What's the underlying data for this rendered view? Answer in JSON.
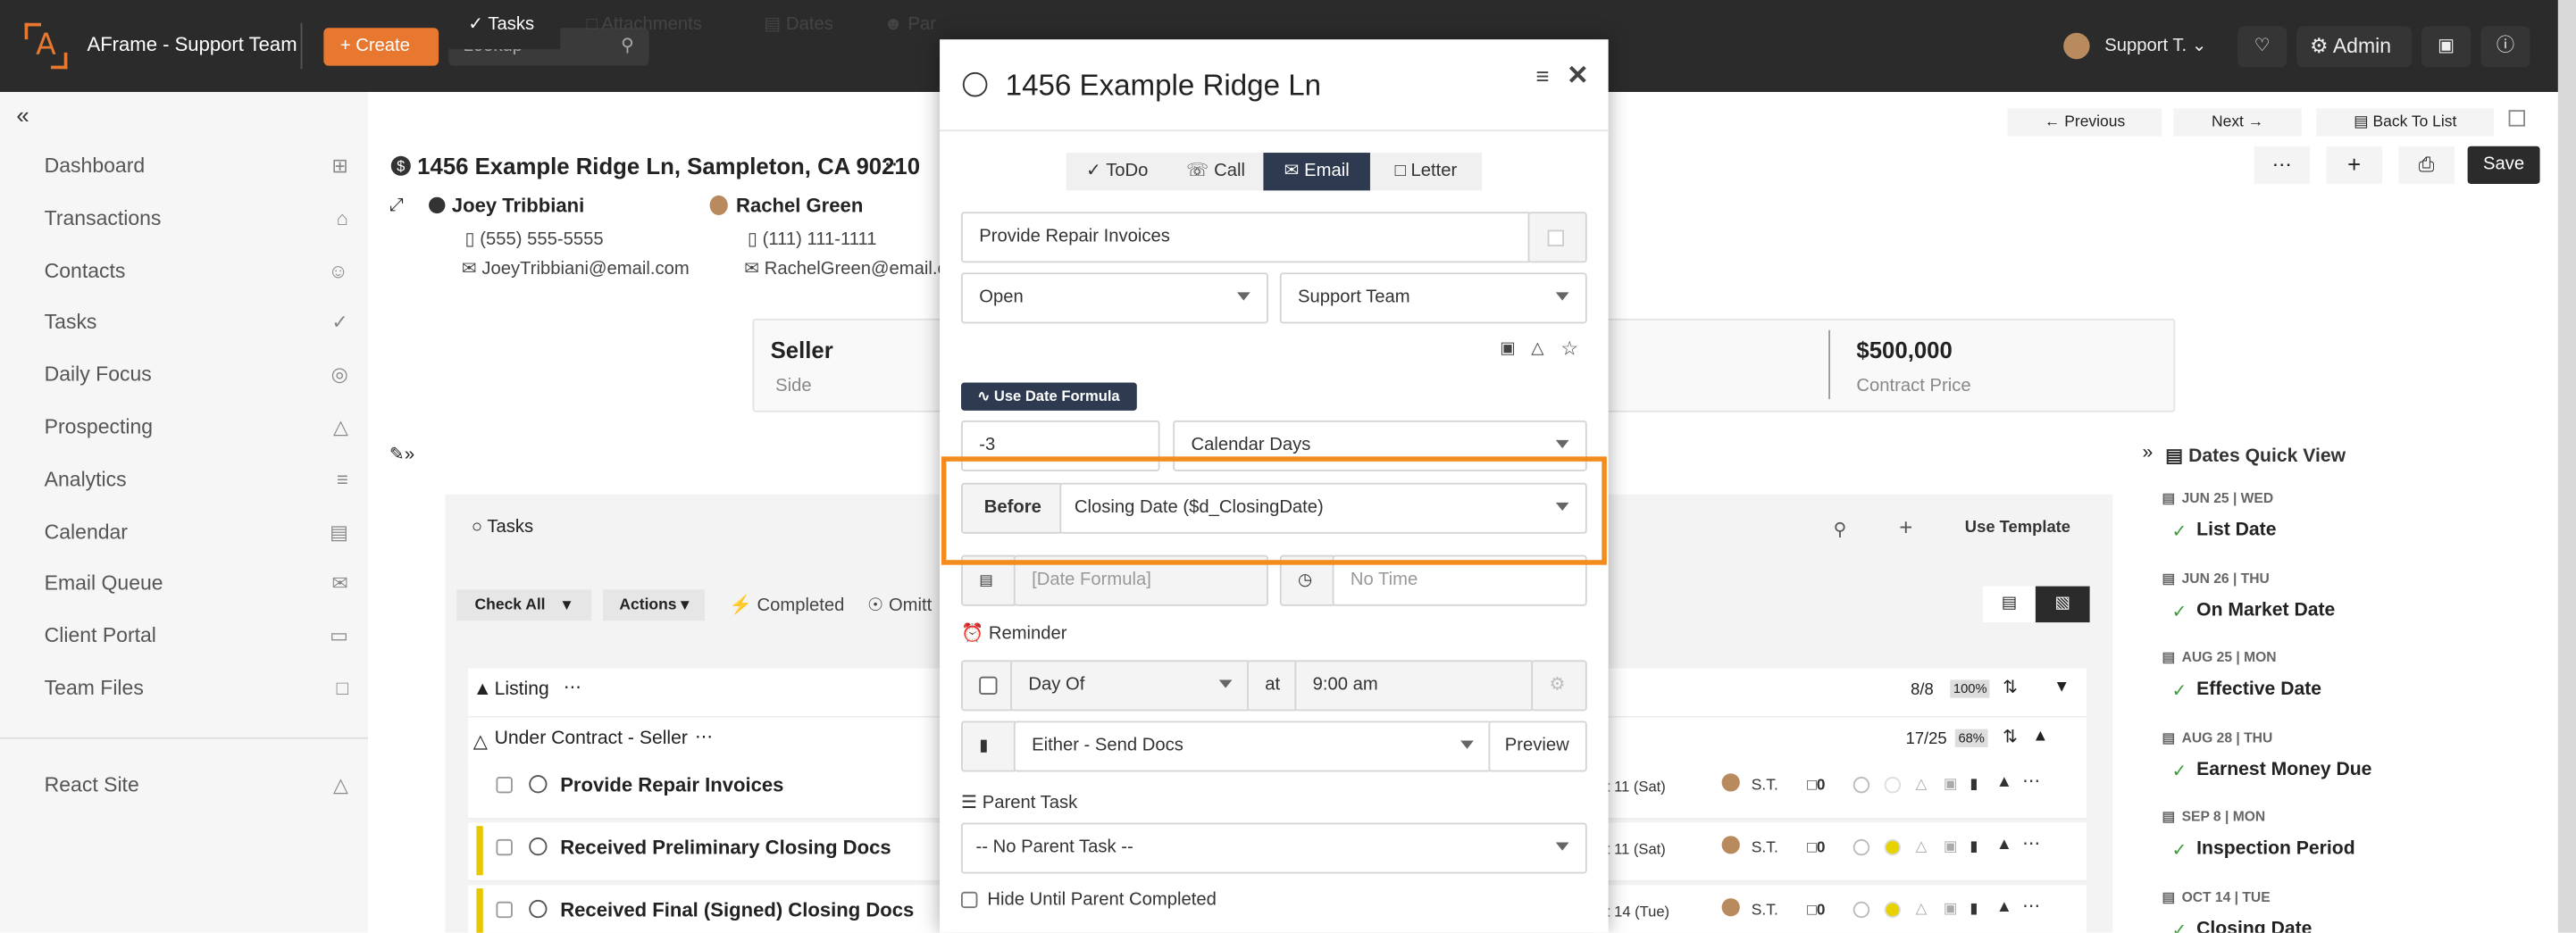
{
  "topbar": {
    "brand": "AFrame - Support Team",
    "create_label": "Create",
    "lookup_placeholder": "Lookup",
    "user_name": "Support T.",
    "admin_label": "Admin"
  },
  "sidebar": {
    "items": [
      {
        "label": "Dashboard",
        "icon": "grid-icon"
      },
      {
        "label": "Transactions",
        "icon": "home-icon"
      },
      {
        "label": "Contacts",
        "icon": "person-icon"
      },
      {
        "label": "Tasks",
        "icon": "check-circle-icon"
      },
      {
        "label": "Daily Focus",
        "icon": "target-icon"
      },
      {
        "label": "Prospecting",
        "icon": "flask-icon"
      },
      {
        "label": "Analytics",
        "icon": "chart-icon"
      },
      {
        "label": "Calendar",
        "icon": "calendar-icon"
      },
      {
        "label": "Email Queue",
        "icon": "email-queue-icon"
      },
      {
        "label": "Client Portal",
        "icon": "card-icon"
      },
      {
        "label": "Team Files",
        "icon": "file-icon"
      }
    ],
    "footer_item": "React Site"
  },
  "transaction": {
    "address": "1456 Example Ridge Ln, Sampleton, CA 90210",
    "contact1": {
      "name": "Joey Tribbiani",
      "phone": "(555) 555-5555",
      "email": "JoeyTribbiani@email.com"
    },
    "contact2": {
      "name": "Rachel Green",
      "phone": "(111) 111-1111",
      "email": "RachelGreen@email.c"
    },
    "side_value": "Seller",
    "side_label": "Side",
    "price_value": "$500,000",
    "price_label": "Contract Price",
    "nav": {
      "previous": "Previous",
      "next": "Next",
      "back": "Back To List",
      "save": "Save"
    }
  },
  "tabs": [
    "Tasks",
    "Attachments",
    "Dates",
    "Par"
  ],
  "tasks_panel": {
    "header": "Tasks",
    "use_template": "Use Template",
    "check_all": "Check All",
    "actions": "Actions",
    "completed": "Completed",
    "omitted": "Omitt",
    "groups": [
      {
        "name": "Listing",
        "count": "8/8",
        "pct": "100%"
      },
      {
        "name": "Under Contract - Seller",
        "count": "17/25",
        "pct": "68%"
      }
    ],
    "rows": [
      {
        "title": "Provide Repair Invoices",
        "date": "ct 11 (Sat)",
        "assignee": "S.T.",
        "comments": "0"
      },
      {
        "title": "Received Preliminary Closing Docs",
        "date": "ct 11 (Sat)",
        "assignee": "S.T.",
        "comments": "0"
      },
      {
        "title": "Received Final (Signed) Closing Docs",
        "date": "ct 14 (Tue)",
        "assignee": "S.T.",
        "comments": "0"
      }
    ]
  },
  "dates_quick_view": {
    "title": "Dates Quick View",
    "items": [
      {
        "date": "JUN 25 | WED",
        "label": "List Date"
      },
      {
        "date": "JUN 26 | THU",
        "label": "On Market Date"
      },
      {
        "date": "AUG 25 | MON",
        "label": "Effective Date"
      },
      {
        "date": "AUG 28 | THU",
        "label": "Earnest Money Due"
      },
      {
        "date": "SEP 8 | MON",
        "label": "Inspection Period"
      },
      {
        "date": "OCT 14 | TUE",
        "label": "Closing Date"
      }
    ]
  },
  "modal": {
    "title": "1456 Example Ridge Ln",
    "types": [
      "ToDo",
      "Call",
      "Email",
      "Letter"
    ],
    "active_type": "Email",
    "task_name": "Provide Repair Invoices",
    "status": "Open",
    "team": "Support Team",
    "use_date_formula": "Use Date Formula",
    "offset": "-3",
    "day_type": "Calendar Days",
    "before_label": "Before",
    "date_ref": "Closing Date ($d_ClosingDate)",
    "date_formula_placeholder": "[Date Formula]",
    "time_placeholder": "No Time",
    "reminder_label": "Reminder",
    "reminder_day": "Day Of",
    "at_label": "at",
    "reminder_time": "9:00 am",
    "send_docs": "Either - Send Docs",
    "preview_label": "Preview",
    "parent_task_label": "Parent Task",
    "parent_task_value": "-- No Parent Task --",
    "hide_until_label": "Hide Until Parent Completed"
  },
  "colors": {
    "accent": "#e8782f",
    "highlight": "#f28c1d",
    "dark": "#2b2b2b",
    "navy": "#2e3a4f",
    "green": "#3a9c3a"
  }
}
